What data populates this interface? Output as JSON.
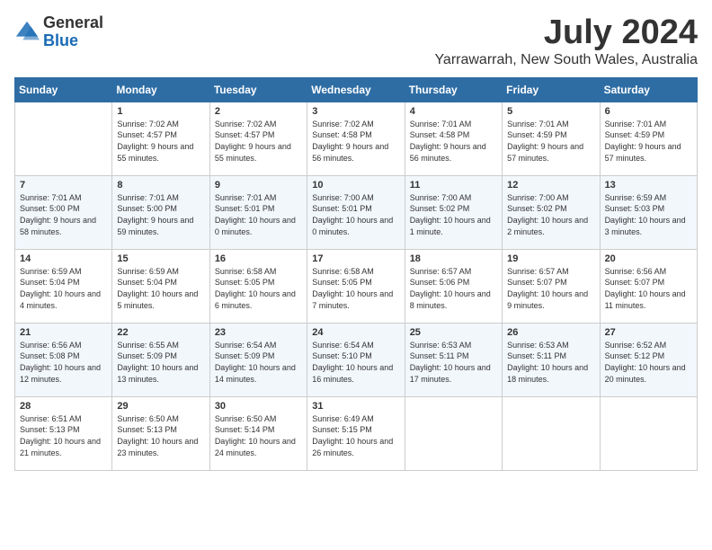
{
  "logo": {
    "general": "General",
    "blue": "Blue"
  },
  "header": {
    "month": "July 2024",
    "location": "Yarrawarrah, New South Wales, Australia"
  },
  "days_of_week": [
    "Sunday",
    "Monday",
    "Tuesday",
    "Wednesday",
    "Thursday",
    "Friday",
    "Saturday"
  ],
  "weeks": [
    [
      {
        "day": "",
        "sunrise": "",
        "sunset": "",
        "daylight": ""
      },
      {
        "day": "1",
        "sunrise": "Sunrise: 7:02 AM",
        "sunset": "Sunset: 4:57 PM",
        "daylight": "Daylight: 9 hours and 55 minutes."
      },
      {
        "day": "2",
        "sunrise": "Sunrise: 7:02 AM",
        "sunset": "Sunset: 4:57 PM",
        "daylight": "Daylight: 9 hours and 55 minutes."
      },
      {
        "day": "3",
        "sunrise": "Sunrise: 7:02 AM",
        "sunset": "Sunset: 4:58 PM",
        "daylight": "Daylight: 9 hours and 56 minutes."
      },
      {
        "day": "4",
        "sunrise": "Sunrise: 7:01 AM",
        "sunset": "Sunset: 4:58 PM",
        "daylight": "Daylight: 9 hours and 56 minutes."
      },
      {
        "day": "5",
        "sunrise": "Sunrise: 7:01 AM",
        "sunset": "Sunset: 4:59 PM",
        "daylight": "Daylight: 9 hours and 57 minutes."
      },
      {
        "day": "6",
        "sunrise": "Sunrise: 7:01 AM",
        "sunset": "Sunset: 4:59 PM",
        "daylight": "Daylight: 9 hours and 57 minutes."
      }
    ],
    [
      {
        "day": "7",
        "sunrise": "Sunrise: 7:01 AM",
        "sunset": "Sunset: 5:00 PM",
        "daylight": "Daylight: 9 hours and 58 minutes."
      },
      {
        "day": "8",
        "sunrise": "Sunrise: 7:01 AM",
        "sunset": "Sunset: 5:00 PM",
        "daylight": "Daylight: 9 hours and 59 minutes."
      },
      {
        "day": "9",
        "sunrise": "Sunrise: 7:01 AM",
        "sunset": "Sunset: 5:01 PM",
        "daylight": "Daylight: 10 hours and 0 minutes."
      },
      {
        "day": "10",
        "sunrise": "Sunrise: 7:00 AM",
        "sunset": "Sunset: 5:01 PM",
        "daylight": "Daylight: 10 hours and 0 minutes."
      },
      {
        "day": "11",
        "sunrise": "Sunrise: 7:00 AM",
        "sunset": "Sunset: 5:02 PM",
        "daylight": "Daylight: 10 hours and 1 minute."
      },
      {
        "day": "12",
        "sunrise": "Sunrise: 7:00 AM",
        "sunset": "Sunset: 5:02 PM",
        "daylight": "Daylight: 10 hours and 2 minutes."
      },
      {
        "day": "13",
        "sunrise": "Sunrise: 6:59 AM",
        "sunset": "Sunset: 5:03 PM",
        "daylight": "Daylight: 10 hours and 3 minutes."
      }
    ],
    [
      {
        "day": "14",
        "sunrise": "Sunrise: 6:59 AM",
        "sunset": "Sunset: 5:04 PM",
        "daylight": "Daylight: 10 hours and 4 minutes."
      },
      {
        "day": "15",
        "sunrise": "Sunrise: 6:59 AM",
        "sunset": "Sunset: 5:04 PM",
        "daylight": "Daylight: 10 hours and 5 minutes."
      },
      {
        "day": "16",
        "sunrise": "Sunrise: 6:58 AM",
        "sunset": "Sunset: 5:05 PM",
        "daylight": "Daylight: 10 hours and 6 minutes."
      },
      {
        "day": "17",
        "sunrise": "Sunrise: 6:58 AM",
        "sunset": "Sunset: 5:05 PM",
        "daylight": "Daylight: 10 hours and 7 minutes."
      },
      {
        "day": "18",
        "sunrise": "Sunrise: 6:57 AM",
        "sunset": "Sunset: 5:06 PM",
        "daylight": "Daylight: 10 hours and 8 minutes."
      },
      {
        "day": "19",
        "sunrise": "Sunrise: 6:57 AM",
        "sunset": "Sunset: 5:07 PM",
        "daylight": "Daylight: 10 hours and 9 minutes."
      },
      {
        "day": "20",
        "sunrise": "Sunrise: 6:56 AM",
        "sunset": "Sunset: 5:07 PM",
        "daylight": "Daylight: 10 hours and 11 minutes."
      }
    ],
    [
      {
        "day": "21",
        "sunrise": "Sunrise: 6:56 AM",
        "sunset": "Sunset: 5:08 PM",
        "daylight": "Daylight: 10 hours and 12 minutes."
      },
      {
        "day": "22",
        "sunrise": "Sunrise: 6:55 AM",
        "sunset": "Sunset: 5:09 PM",
        "daylight": "Daylight: 10 hours and 13 minutes."
      },
      {
        "day": "23",
        "sunrise": "Sunrise: 6:54 AM",
        "sunset": "Sunset: 5:09 PM",
        "daylight": "Daylight: 10 hours and 14 minutes."
      },
      {
        "day": "24",
        "sunrise": "Sunrise: 6:54 AM",
        "sunset": "Sunset: 5:10 PM",
        "daylight": "Daylight: 10 hours and 16 minutes."
      },
      {
        "day": "25",
        "sunrise": "Sunrise: 6:53 AM",
        "sunset": "Sunset: 5:11 PM",
        "daylight": "Daylight: 10 hours and 17 minutes."
      },
      {
        "day": "26",
        "sunrise": "Sunrise: 6:53 AM",
        "sunset": "Sunset: 5:11 PM",
        "daylight": "Daylight: 10 hours and 18 minutes."
      },
      {
        "day": "27",
        "sunrise": "Sunrise: 6:52 AM",
        "sunset": "Sunset: 5:12 PM",
        "daylight": "Daylight: 10 hours and 20 minutes."
      }
    ],
    [
      {
        "day": "28",
        "sunrise": "Sunrise: 6:51 AM",
        "sunset": "Sunset: 5:13 PM",
        "daylight": "Daylight: 10 hours and 21 minutes."
      },
      {
        "day": "29",
        "sunrise": "Sunrise: 6:50 AM",
        "sunset": "Sunset: 5:13 PM",
        "daylight": "Daylight: 10 hours and 23 minutes."
      },
      {
        "day": "30",
        "sunrise": "Sunrise: 6:50 AM",
        "sunset": "Sunset: 5:14 PM",
        "daylight": "Daylight: 10 hours and 24 minutes."
      },
      {
        "day": "31",
        "sunrise": "Sunrise: 6:49 AM",
        "sunset": "Sunset: 5:15 PM",
        "daylight": "Daylight: 10 hours and 26 minutes."
      },
      {
        "day": "",
        "sunrise": "",
        "sunset": "",
        "daylight": ""
      },
      {
        "day": "",
        "sunrise": "",
        "sunset": "",
        "daylight": ""
      },
      {
        "day": "",
        "sunrise": "",
        "sunset": "",
        "daylight": ""
      }
    ]
  ]
}
